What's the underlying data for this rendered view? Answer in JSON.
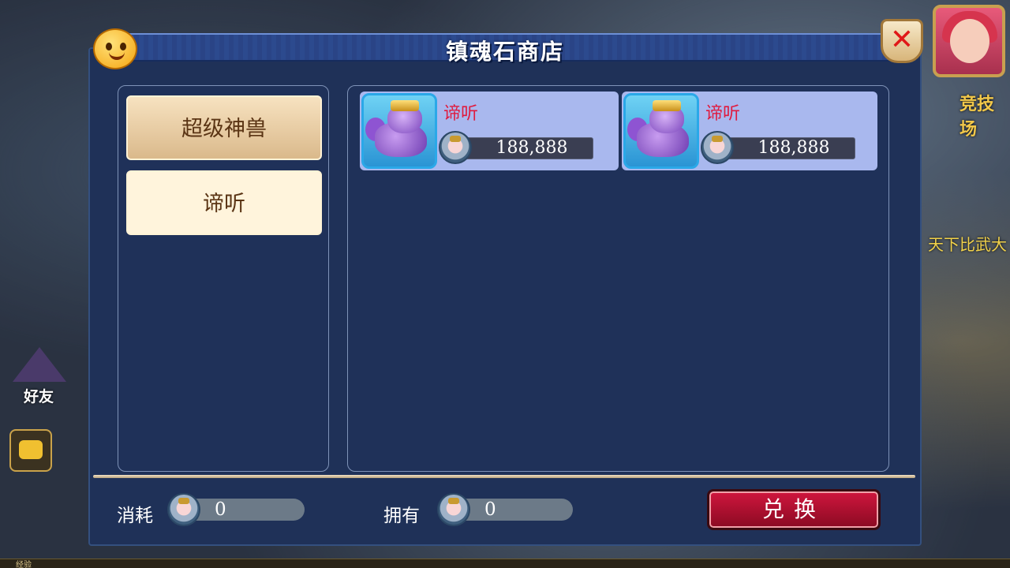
{
  "hud": {
    "right_label_1": "竞技场",
    "right_label_2": "天下比武大",
    "friend_label": "好友",
    "exp_label": "经验"
  },
  "shop": {
    "title": "镇魂石商店",
    "categories": [
      {
        "label": "超级神兽",
        "selected": true
      },
      {
        "label": "谛听",
        "selected": false
      }
    ],
    "items": [
      {
        "name": "谛听",
        "price": "188,888",
        "icon": "ditin-beast-icon"
      },
      {
        "name": "谛听",
        "price": "188,888",
        "icon": "ditin-beast-icon"
      }
    ],
    "footer": {
      "consume_label": "消耗",
      "consume_value": "0",
      "own_label": "拥有",
      "own_value": "0",
      "exchange_label": "兑换"
    }
  },
  "colors": {
    "dialog_bg": "#1f3158",
    "item_name": "#e01a3e",
    "exchange_button": "#c0143a",
    "category_active": "#e8cba0"
  }
}
